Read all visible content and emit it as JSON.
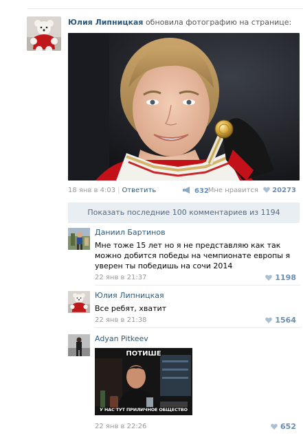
{
  "post": {
    "author": "Юлия Липницкая",
    "action": "обновила фотографию на странице:",
    "date": "18 янв в 4:03",
    "reply_label": "Ответить",
    "separator": "|",
    "shares": "632",
    "like_label": "Мне нравится",
    "likes": "20273"
  },
  "show_more": "Показать последние 100 комментариев из 1194",
  "comments": [
    {
      "author": "Даниил Бартинов",
      "text": "Мне тоже 15 лет но я не представляю как так можно добится победы на чемпионате европы я уверен ты победишь на сочи 2014",
      "date": "22 янв в 21:37",
      "likes": "1198"
    },
    {
      "author": "Юлия Липницкая",
      "text": "Все ребят, хватит",
      "date": "22 янв в 21:38",
      "likes": "1564"
    },
    {
      "author": "Adyan Pitkeev",
      "meme_top": "ПОТИШЕ",
      "meme_bottom": "У НАС ТУТ ПРИЛИЧНОЕ ОБЩЕСТВО",
      "date": "22 янв в 22:26",
      "likes": "652"
    }
  ],
  "colors": {
    "link": "#2b587a",
    "like_count": "#6a8cb0",
    "show_more_bg": "#e9eef3"
  }
}
